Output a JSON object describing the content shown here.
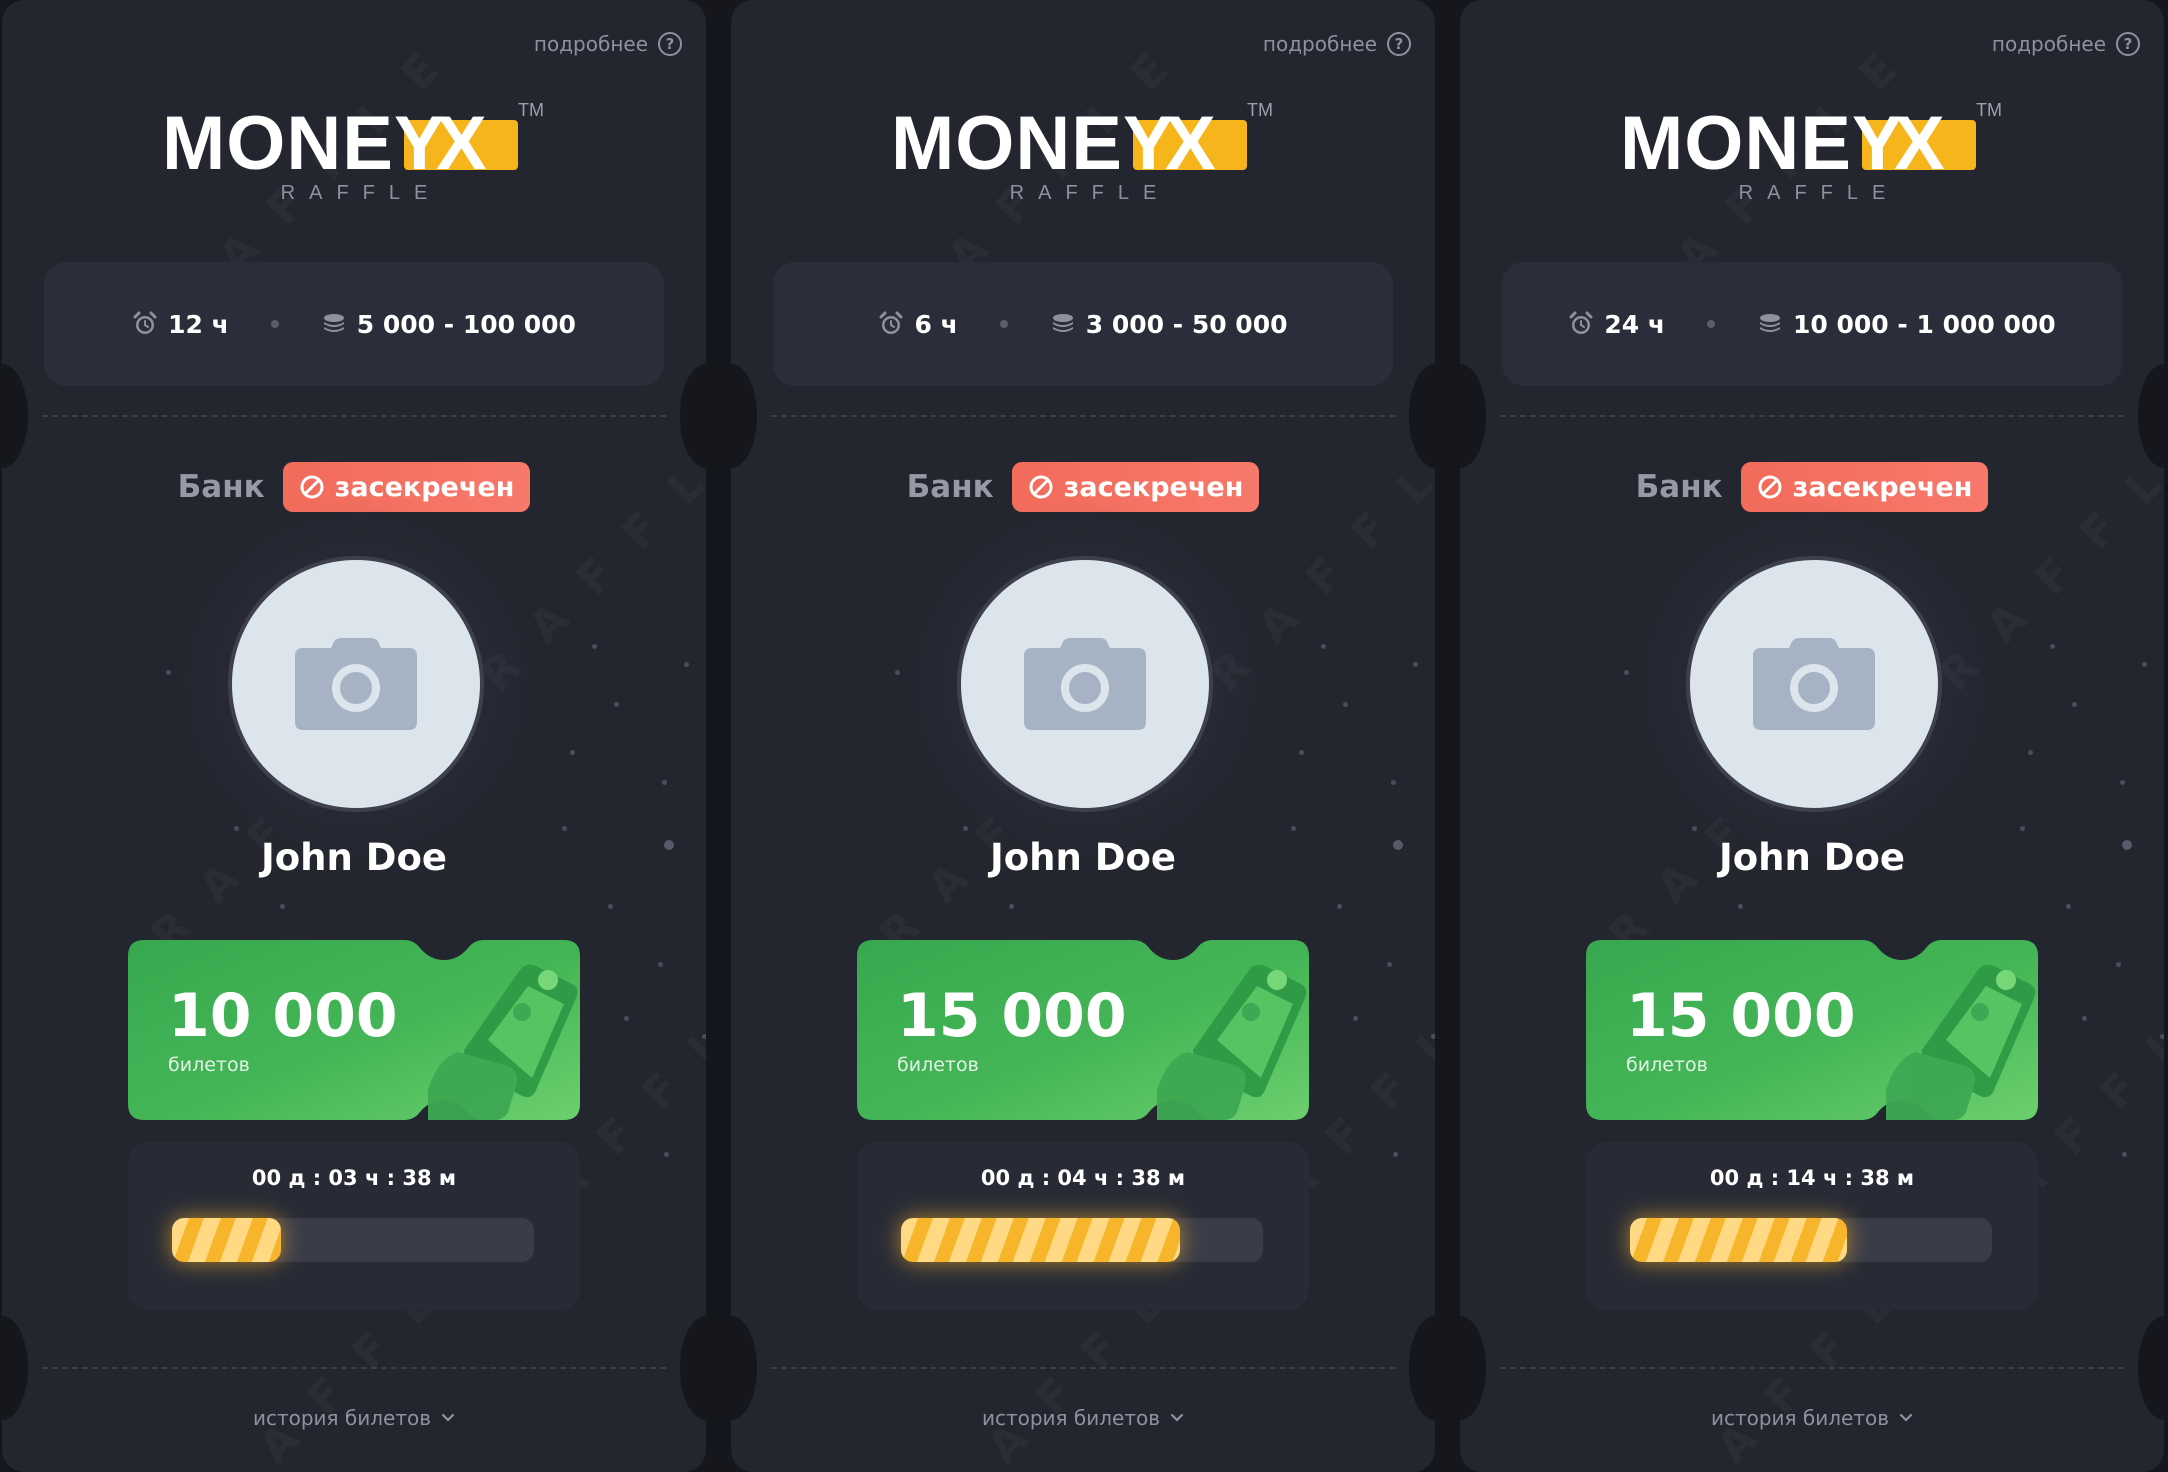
{
  "colors": {
    "page_bg": "#16171d",
    "card_bg": "#23252f",
    "accent_yellow": "#f6b51a",
    "badge_red": "#f26b5b",
    "ticket_green": "#4caf50"
  },
  "cards": [
    {
      "more_label": "подробнее",
      "logo": {
        "word": "MONEY",
        "x": "X",
        "tm": "TM",
        "sub": "RAFFLE"
      },
      "duration": "12 ч",
      "range": "5 000 - 100 000",
      "bank_label": "Банк",
      "bank_status": "засекречен",
      "name": "John Doe",
      "tickets": "10 000",
      "tickets_unit": "билетов",
      "timer": "00 д : 03 ч : 38 м",
      "progress": 0.3,
      "history": "история билетов",
      "icons": [
        "help-icon",
        "alarm-clock-icon",
        "coins-icon",
        "ban-icon",
        "camera-icon",
        "chevron-down-icon"
      ]
    },
    {
      "more_label": "подробнее",
      "logo": {
        "word": "MONEY",
        "x": "X",
        "tm": "TM",
        "sub": "RAFFLE"
      },
      "duration": "6 ч",
      "range": "3 000 - 50 000",
      "bank_label": "Банк",
      "bank_status": "засекречен",
      "name": "John Doe",
      "tickets": "15 000",
      "tickets_unit": "билетов",
      "timer": "00 д : 04 ч : 38 м",
      "progress": 0.77,
      "history": "история билетов",
      "icons": [
        "help-icon",
        "alarm-clock-icon",
        "coins-icon",
        "ban-icon",
        "camera-icon",
        "chevron-down-icon"
      ]
    },
    {
      "more_label": "подробнее",
      "logo": {
        "word": "MONEY",
        "x": "X",
        "tm": "TM",
        "sub": "RAFFLE"
      },
      "duration": "24 ч",
      "range": "10 000 - 1 000 000",
      "bank_label": "Банк",
      "bank_status": "засекречен",
      "name": "John Doe",
      "tickets": "15 000",
      "tickets_unit": "билетов",
      "timer": "00 д : 14 ч : 38 м",
      "progress": 0.6,
      "history": "история билетов",
      "icons": [
        "help-icon",
        "alarm-clock-icon",
        "coins-icon",
        "ban-icon",
        "camera-icon",
        "chevron-down-icon"
      ]
    }
  ]
}
